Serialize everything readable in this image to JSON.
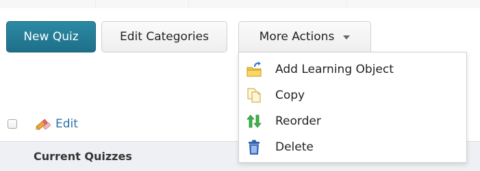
{
  "toolbar": {
    "new_quiz_label": "New Quiz",
    "edit_categories_label": "Edit Categories",
    "more_actions_label": "More Actions"
  },
  "more_actions_menu": {
    "items": [
      {
        "label": "Add Learning Object",
        "icon": "add-learning-object-icon"
      },
      {
        "label": "Copy",
        "icon": "copy-icon"
      },
      {
        "label": "Reorder",
        "icon": "reorder-icon"
      },
      {
        "label": "Delete",
        "icon": "delete-icon"
      }
    ]
  },
  "bulk_actions": {
    "edit_label": "Edit",
    "edit_icon": "pencil-eraser-icon"
  },
  "table": {
    "section_header": "Current Quizzes"
  },
  "colors": {
    "primary_button": "#1e6f88",
    "link": "#2a6fa8",
    "header_bar": "#eef0f3"
  }
}
